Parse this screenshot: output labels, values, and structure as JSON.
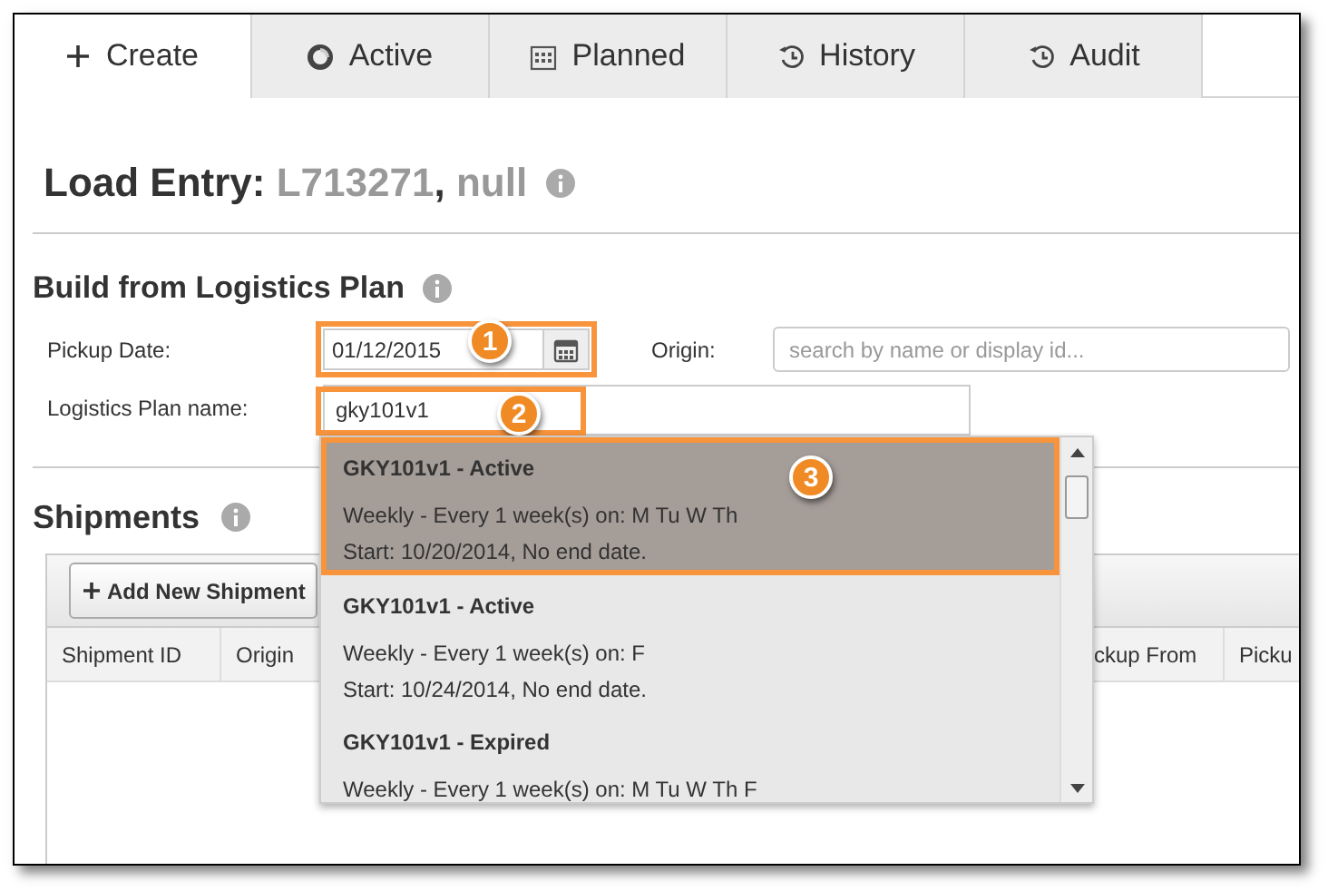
{
  "tabs": [
    {
      "label": "Create",
      "kind": "create",
      "selected": true
    },
    {
      "label": "Active",
      "kind": "active",
      "selected": false
    },
    {
      "label": "Planned",
      "kind": "planned",
      "selected": false
    },
    {
      "label": "History",
      "kind": "history",
      "selected": false
    },
    {
      "label": "Audit",
      "kind": "audit",
      "selected": false
    }
  ],
  "page_title": {
    "label": "Load Entry:",
    "load_id": "L713271",
    "separator": ",",
    "name": "null"
  },
  "plan_section": {
    "heading": "Build from Logistics Plan",
    "pickup_date": {
      "label": "Pickup Date:",
      "value": "01/12/2015",
      "callout": "1"
    },
    "origin": {
      "label": "Origin:",
      "placeholder": "search by name or display id..."
    },
    "plan_name": {
      "label": "Logistics Plan name:",
      "value": "gky101v1",
      "callout": "2"
    }
  },
  "shipments": {
    "heading": "Shipments",
    "add_button": "Add New Shipment",
    "columns": [
      "Shipment ID",
      "Origin",
      "ckup From",
      "Picku"
    ]
  },
  "dropdown": {
    "items": [
      {
        "title": "GKY101v1 - Active",
        "schedule": "Weekly - Every 1 week(s) on: M Tu W Th",
        "start": "Start: 10/20/2014, No end date.",
        "selected": true,
        "callout": "3"
      },
      {
        "title": "GKY101v1 - Active",
        "schedule": "Weekly - Every 1 week(s) on: F",
        "start": "Start: 10/24/2014, No end date.",
        "selected": false
      },
      {
        "title": "GKY101v1 - Expired",
        "schedule": "Weekly - Every 1 week(s) on: M Tu W Th F",
        "selected": false
      }
    ]
  }
}
